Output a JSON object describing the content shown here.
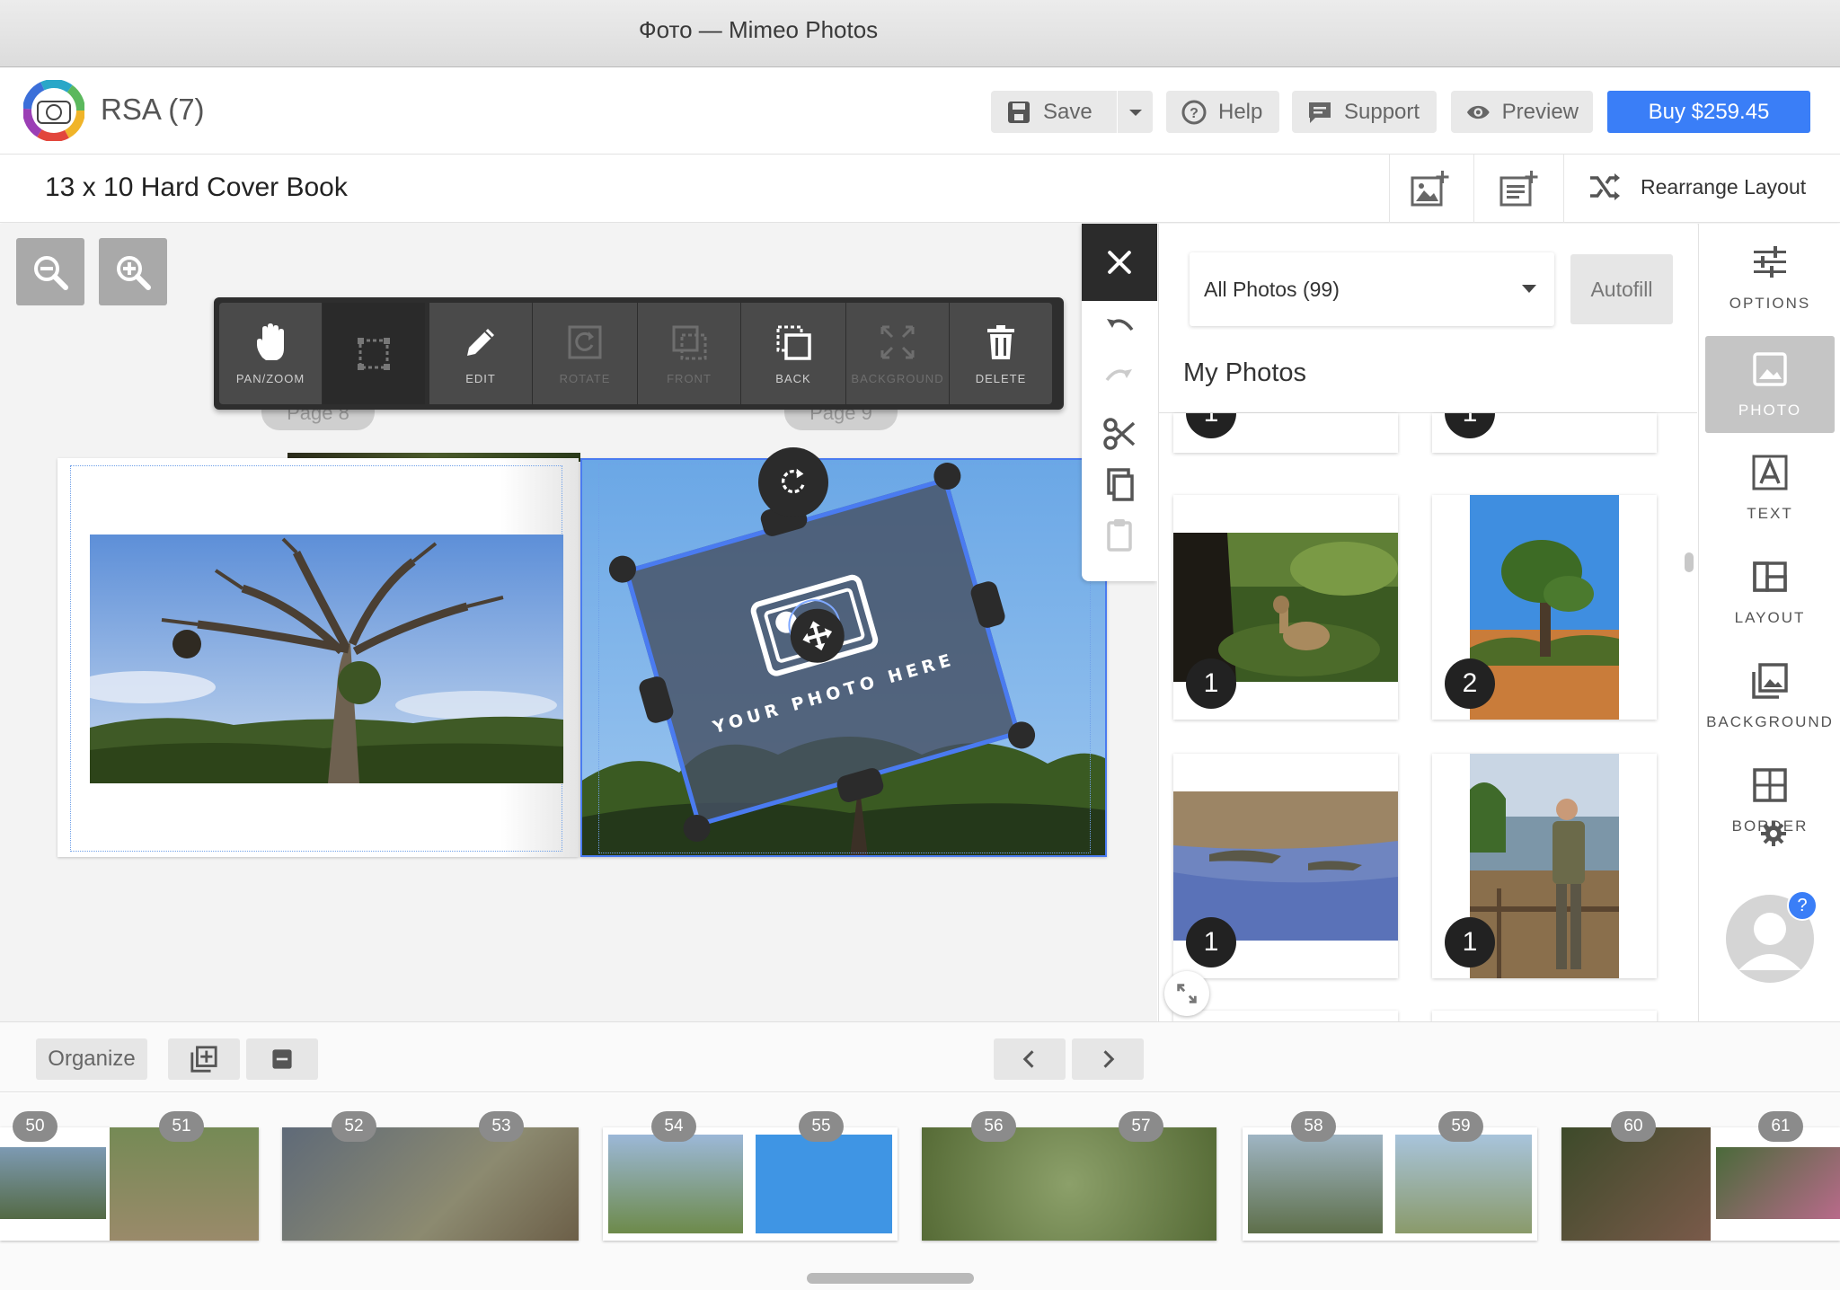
{
  "window": {
    "title": "Фото — Mimeo Photos"
  },
  "header": {
    "project_name": "RSA (7)",
    "save_label": "Save",
    "help_label": "Help",
    "support_label": "Support",
    "preview_label": "Preview",
    "buy_label": "Buy $259.45"
  },
  "bookbar": {
    "title": "13 x 10 Hard Cover Book",
    "rearrange_label": "Rearrange Layout"
  },
  "toolbar": {
    "tools": [
      {
        "label": "PAN/ZOOM",
        "icon": "hand-icon",
        "enabled": true
      },
      {
        "label": "",
        "icon": "crop-frame-icon",
        "enabled": true
      },
      {
        "label": "EDIT",
        "icon": "pencil-icon",
        "enabled": true
      },
      {
        "label": "ROTATE",
        "icon": "rotate-icon",
        "enabled": false
      },
      {
        "label": "FRONT",
        "icon": "bring-front-icon",
        "enabled": false
      },
      {
        "label": "BACK",
        "icon": "send-back-icon",
        "enabled": true
      },
      {
        "label": "BACKGROUND",
        "icon": "expand-icon",
        "enabled": false
      },
      {
        "label": "DELETE",
        "icon": "trash-icon",
        "enabled": true
      }
    ]
  },
  "canvas": {
    "page_tabs": [
      "Page 8",
      "Page 9"
    ],
    "placeholder_text": "YOUR PHOTO HERE"
  },
  "photo_panel": {
    "filter_selected": "All Photos (99)",
    "autofill_label": "Autofill",
    "section_title": "My Photos",
    "photos": [
      {
        "subject": "antelope",
        "count": "1"
      },
      {
        "subject": "baobab-tree",
        "count": "2"
      },
      {
        "subject": "crocodiles-river",
        "count": "1"
      },
      {
        "subject": "photographer",
        "count": "1"
      }
    ],
    "partial_counts": [
      "1",
      "1"
    ]
  },
  "sidebar": {
    "items": [
      {
        "label": "OPTIONS",
        "icon": "sliders-icon"
      },
      {
        "label": "PHOTO",
        "icon": "photo-icon",
        "active": true
      },
      {
        "label": "TEXT",
        "icon": "text-icon"
      },
      {
        "label": "LAYOUT",
        "icon": "layout-icon"
      },
      {
        "label": "BACKGROUND",
        "icon": "background-icon"
      },
      {
        "label": "BORDER",
        "icon": "border-icon"
      }
    ],
    "help_badge": "?"
  },
  "bottom": {
    "organize_label": "Organize"
  },
  "filmstrip": {
    "pages": [
      "50",
      "51",
      "52",
      "53",
      "54",
      "55",
      "56",
      "57",
      "58",
      "59",
      "60",
      "61"
    ]
  },
  "colors": {
    "accent": "#3a7ef7",
    "selection": "#4a7bf0",
    "toolbar_bg": "#2e2e2e"
  }
}
